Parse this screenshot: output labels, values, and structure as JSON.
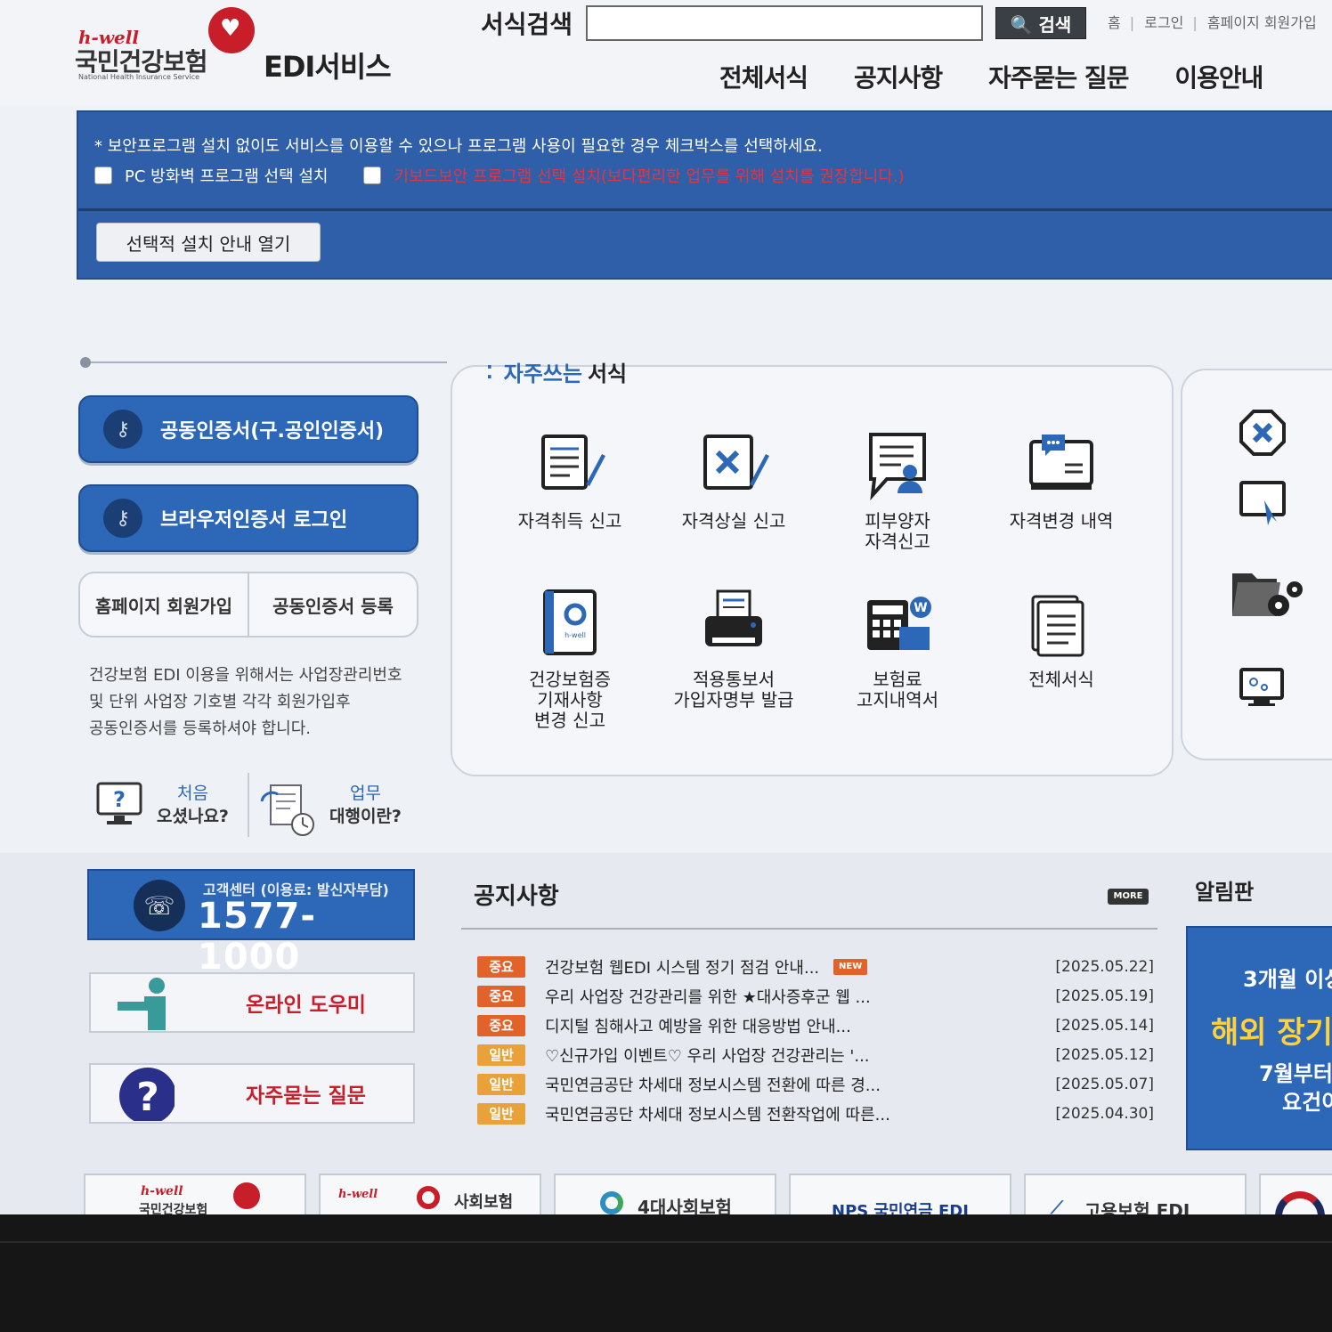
{
  "header": {
    "logo_hwell": "h-well",
    "logo_org": "국민건강보험",
    "logo_eng": "National Health Insurance Service",
    "service_title": "EDI서비스",
    "search_label": "서식검색",
    "search_value": "",
    "search_button": "검색",
    "top_links": [
      "홈",
      "로그인",
      "홈페이지 회원가입"
    ],
    "nav": [
      "전체서식",
      "공지사항",
      "자주묻는 질문",
      "이용안내"
    ]
  },
  "security": {
    "notice": "* 보안프로그램 설치 없이도 서비스를 이용할 수 있으나 프로그램 사용이 필요한 경우 체크박스를 선택하세요.",
    "option1": "PC 방화벽 프로그램 선택 설치",
    "option2": "키보드보안 프로그램 선택 설치(보다편리한 업무를 위해 설치를 권장합니다.)",
    "guide_button": "선택적 설치 안내 열기"
  },
  "login": {
    "cert_button": "공동인증서(구.공인인증서)",
    "browser_button": "브라우저인증서 로그인",
    "join": "홈페이지 회원가입",
    "register_cert": "공동인증서 등록",
    "note_lines": [
      "건강보험 EDI 이용을 위해서는 사업장관리번호",
      "및 단위 사업장 기호별 각각 회원가입후",
      "공동인증서를 등록하셔야 합니다."
    ],
    "first_visit_a": "처음",
    "first_visit_b": "오셨나요?",
    "agency_a": "업무",
    "agency_b": "대행이란?"
  },
  "favorites": {
    "title_hl": "자주쓰는",
    "title": "서식",
    "items": [
      {
        "label": "자격취득 신고",
        "icon": "document-pen-icon"
      },
      {
        "label": "자격상실 신고",
        "icon": "document-x-icon"
      },
      {
        "label": "피부양자\n자격신고",
        "icon": "person-speech-icon"
      },
      {
        "label": "자격변경 내역",
        "icon": "monitor-chat-icon"
      },
      {
        "label": "건강보험증\n기재사항\n변경 신고",
        "icon": "insurance-card-icon"
      },
      {
        "label": "적용통보서\n가입자명부 발급",
        "icon": "printer-icon"
      },
      {
        "label": "보험료\n고지내역서",
        "icon": "calculator-icon"
      },
      {
        "label": "전체서식",
        "icon": "document-stack-icon"
      }
    ]
  },
  "tools": [
    "close-circle-icon",
    "screen-cursor-icon",
    "folder-gear-icon",
    "monitor-settings-icon"
  ],
  "support": {
    "center_label": "고객센터 (이용료: 발신자부담)",
    "phone": "1577-1000",
    "online_help": "온라인 도우미",
    "faq": "자주묻는 질문"
  },
  "notices": {
    "title": "공지사항",
    "more": "MORE",
    "new_label": "NEW",
    "items": [
      {
        "badge": "중요",
        "type": "imp",
        "title": "건강보험 웹EDI 시스템 정기 점검 안내...",
        "date": "[2025.05.22]",
        "new": true
      },
      {
        "badge": "중요",
        "type": "imp",
        "title": "우리 사업장 건강관리를 위한 ★대사증후군 웹 ...",
        "date": "[2025.05.19]",
        "new": false
      },
      {
        "badge": "중요",
        "type": "imp",
        "title": "디지털 침해사고 예방을 위한 대응방법 안내...",
        "date": "[2025.05.14]",
        "new": false
      },
      {
        "badge": "일반",
        "type": "gen",
        "title": "♡신규가입 이벤트♡ 우리 사업장 건강관리는 '...",
        "date": "[2025.05.12]",
        "new": false
      },
      {
        "badge": "일반",
        "type": "gen",
        "title": "국민연금공단 차세대 정보시스템 전환에 따른 경...",
        "date": "[2025.05.07]",
        "new": false
      },
      {
        "badge": "일반",
        "type": "gen",
        "title": "국민연금공단 차세대 정보시스템 전환작업에 따른...",
        "date": "[2025.04.30]",
        "new": false
      }
    ]
  },
  "board": {
    "title": "알림판",
    "line1": "3개월 이상",
    "line2": "해외 장기",
    "line3": "7월부터",
    "line4": "요건이"
  },
  "banners": [
    "국민건강보험",
    "사회보험",
    "4대사회보험",
    "NPS 국민연금 EDI",
    "고용보험 EDI"
  ]
}
